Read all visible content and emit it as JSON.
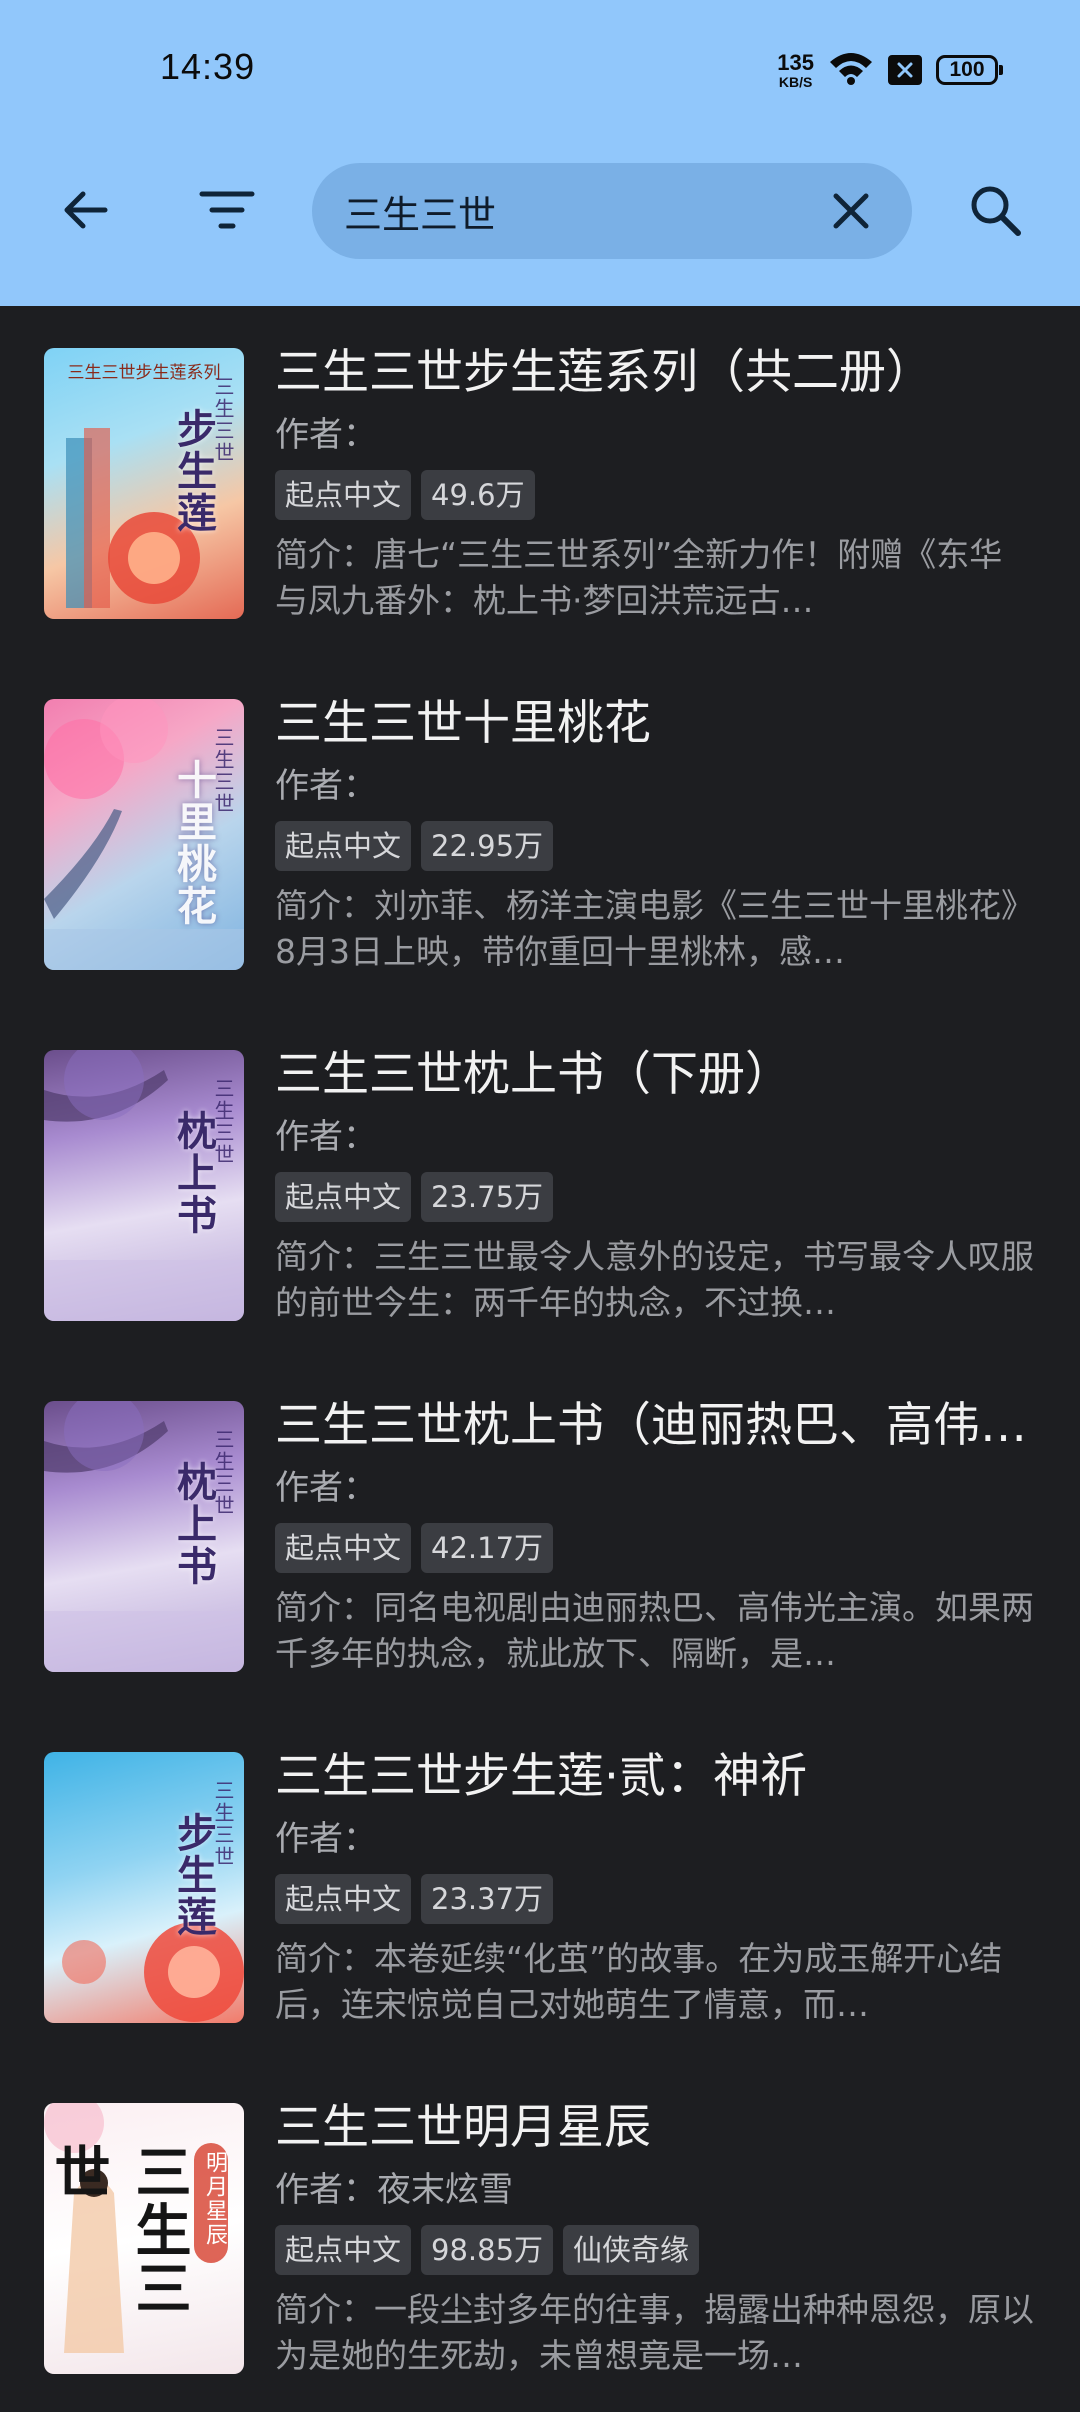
{
  "status_bar": {
    "time": "14:39",
    "net_speed_value": "135",
    "net_speed_unit": "KB/S",
    "battery": "100"
  },
  "toolbar": {
    "search_value": "三生三世",
    "icons": [
      "back-arrow-icon",
      "filter-icon",
      "clear-icon",
      "search-icon"
    ]
  },
  "books": [
    {
      "title": "三生三世步生莲系列（共二册）",
      "author": "作者：",
      "tags": [
        "起点中文",
        "49.6万"
      ],
      "intro": "简介：唐七“三生三世系列”全新力作！附赠《东华与凤九番外：枕上书·梦回洪荒远古…",
      "cover": {
        "top_text": "三生三世步生莲系列",
        "vertical_text": "步生莲",
        "vertical_sub": "三生三世",
        "style": "light-blue"
      }
    },
    {
      "title": "三生三世十里桃花",
      "author": "作者：",
      "tags": [
        "起点中文",
        "22.95万"
      ],
      "intro": "简介：刘亦菲、杨洋主演电影《三生三世十里桃花》8月3日上映，带你重回十里桃林，感…",
      "cover": {
        "top_text": "",
        "vertical_text": "十里桃花",
        "vertical_sub": "三生三世",
        "style": "pink"
      }
    },
    {
      "title": "三生三世枕上书（下册）",
      "author": "作者：",
      "tags": [
        "起点中文",
        "23.75万"
      ],
      "intro": "简介：三生三世最令人意外的设定，书写最令人叹服的前世今生：两千年的执念，不过换…",
      "cover": {
        "top_text": "",
        "vertical_text": "枕上书",
        "vertical_sub": "三生三世",
        "style": "purple"
      }
    },
    {
      "title": "三生三世枕上书（迪丽热巴、高伟光主演）",
      "author": "作者：",
      "tags": [
        "起点中文",
        "42.17万"
      ],
      "intro": "简介：同名电视剧由迪丽热巴、高伟光主演。如果两千多年的执念，就此放下、隔断，是…",
      "cover": {
        "top_text": "",
        "vertical_text": "枕上书",
        "vertical_sub": "三生三世",
        "style": "purple"
      }
    },
    {
      "title": "三生三世步生莲·贰：神祈",
      "author": "作者：",
      "tags": [
        "起点中文",
        "23.37万"
      ],
      "intro": "简介：本卷延续“化茧”的故事。在为成玉解开心结后，连宋惊觉自己对她萌生了情意，而…",
      "cover": {
        "top_text": "",
        "vertical_text": "步生莲",
        "vertical_sub": "三生三世",
        "style": "blue-red"
      }
    },
    {
      "title": "三生三世明月星辰",
      "author": "作者：夜末炫雪",
      "tags": [
        "起点中文",
        "98.85万",
        "仙侠奇缘"
      ],
      "intro": "简介：一段尘封多年的往事，揭露出种种恩怨，原以为是她的生死劫，未曾想竟是一场…",
      "cover": {
        "top_text": "",
        "vertical_text": "三生三世",
        "vertical_sub": "明月星辰",
        "style": "white"
      }
    }
  ],
  "colors": {
    "appbar": "#91c7fb",
    "background": "#1d1e21",
    "tag_bg": "#3b3d42"
  }
}
